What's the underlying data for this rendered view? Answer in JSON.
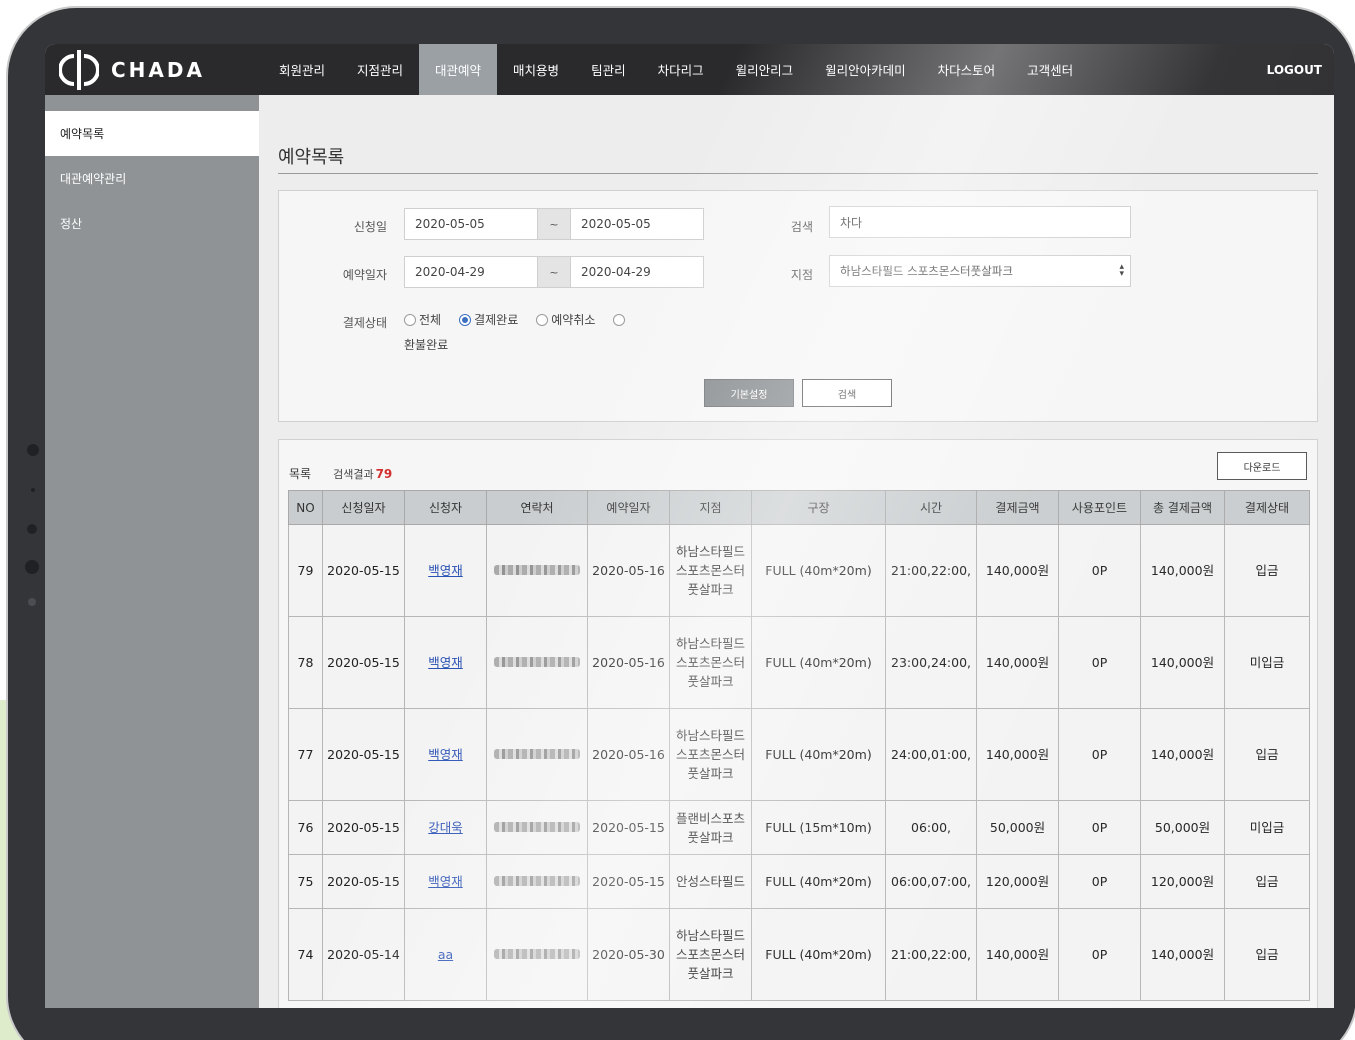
{
  "brand": {
    "name": "CHADA",
    "logo_icon": "phi-logo-icon"
  },
  "nav": {
    "items": [
      {
        "label": "회원관리",
        "active": false
      },
      {
        "label": "지점관리",
        "active": false
      },
      {
        "label": "대관예약",
        "active": true
      },
      {
        "label": "매치용병",
        "active": false
      },
      {
        "label": "팀관리",
        "active": false
      },
      {
        "label": "차다리그",
        "active": false
      },
      {
        "label": "윌리안리그",
        "active": false
      },
      {
        "label": "윌리안아카데미",
        "active": false
      },
      {
        "label": "차다스토어",
        "active": false
      },
      {
        "label": "고객센터",
        "active": false
      }
    ],
    "logout": "LOGOUT"
  },
  "sidebar": {
    "items": [
      {
        "label": "예약목록",
        "active": true
      },
      {
        "label": "대관예약관리",
        "active": false
      },
      {
        "label": "정산",
        "active": false
      }
    ]
  },
  "page": {
    "title": "예약목록"
  },
  "search": {
    "apply_date_label": "신청일",
    "apply_date_from": "2020-05-05",
    "apply_date_to": "2020-05-05",
    "reserve_date_label": "예약일자",
    "reserve_date_from": "2020-04-29",
    "reserve_date_to": "2020-04-29",
    "range_separator": "~",
    "keyword_label": "검색",
    "keyword_value": "차다",
    "branch_label": "지점",
    "branch_value": "하남스타필드 스포츠몬스터풋살파크",
    "payment_label": "결제상태",
    "payment_options": [
      {
        "label": "전체",
        "checked": false
      },
      {
        "label": "결제완료",
        "checked": true
      },
      {
        "label": "예약취소",
        "checked": false
      },
      {
        "label": "환불완료",
        "checked": false
      }
    ],
    "reset_button": "기본설정",
    "search_button": "검색"
  },
  "list": {
    "title": "목록",
    "count_label": "검색결과",
    "count": "79",
    "download_button": "다운로드",
    "columns": [
      "NO",
      "신청일자",
      "신청자",
      "연락처",
      "예약일자",
      "지점",
      "구장",
      "시간",
      "결제금액",
      "사용포인트",
      "총 결제금액",
      "결제상태"
    ],
    "rows": [
      {
        "no": "79",
        "apply_date": "2020-05-15",
        "applicant": "백영재",
        "reserve_date": "2020-05-16",
        "branch": "하남스타필드 스포츠몬스터풋살파크",
        "field": "FULL (40m*20m)",
        "time": "21:00,22:00,",
        "amount": "140,000원",
        "points": "0P",
        "total": "140,000원",
        "status": "입금"
      },
      {
        "no": "78",
        "apply_date": "2020-05-15",
        "applicant": "백영재",
        "reserve_date": "2020-05-16",
        "branch": "하남스타필드 스포츠몬스터풋살파크",
        "field": "FULL (40m*20m)",
        "time": "23:00,24:00,",
        "amount": "140,000원",
        "points": "0P",
        "total": "140,000원",
        "status": "미입금"
      },
      {
        "no": "77",
        "apply_date": "2020-05-15",
        "applicant": "백영재",
        "reserve_date": "2020-05-16",
        "branch": "하남스타필드 스포츠몬스터풋살파크",
        "field": "FULL (40m*20m)",
        "time": "24:00,01:00,",
        "amount": "140,000원",
        "points": "0P",
        "total": "140,000원",
        "status": "입금"
      },
      {
        "no": "76",
        "apply_date": "2020-05-15",
        "applicant": "강대욱",
        "reserve_date": "2020-05-15",
        "branch": "플랜비스포츠풋살파크",
        "field": "FULL (15m*10m)",
        "time": "06:00,",
        "amount": "50,000원",
        "points": "0P",
        "total": "50,000원",
        "status": "미입금"
      },
      {
        "no": "75",
        "apply_date": "2020-05-15",
        "applicant": "백영재",
        "reserve_date": "2020-05-15",
        "branch": "안성스타필드",
        "field": "FULL (40m*20m)",
        "time": "06:00,07:00,",
        "amount": "120,000원",
        "points": "0P",
        "total": "120,000원",
        "status": "입금"
      },
      {
        "no": "74",
        "apply_date": "2020-05-14",
        "applicant": "aa",
        "reserve_date": "2020-05-30",
        "branch": "하남스타필드 스포츠몬스터풋살파크",
        "field": "FULL (40m*20m)",
        "time": "21:00,22:00,",
        "amount": "140,000원",
        "points": "0P",
        "total": "140,000원",
        "status": "입금"
      }
    ]
  }
}
